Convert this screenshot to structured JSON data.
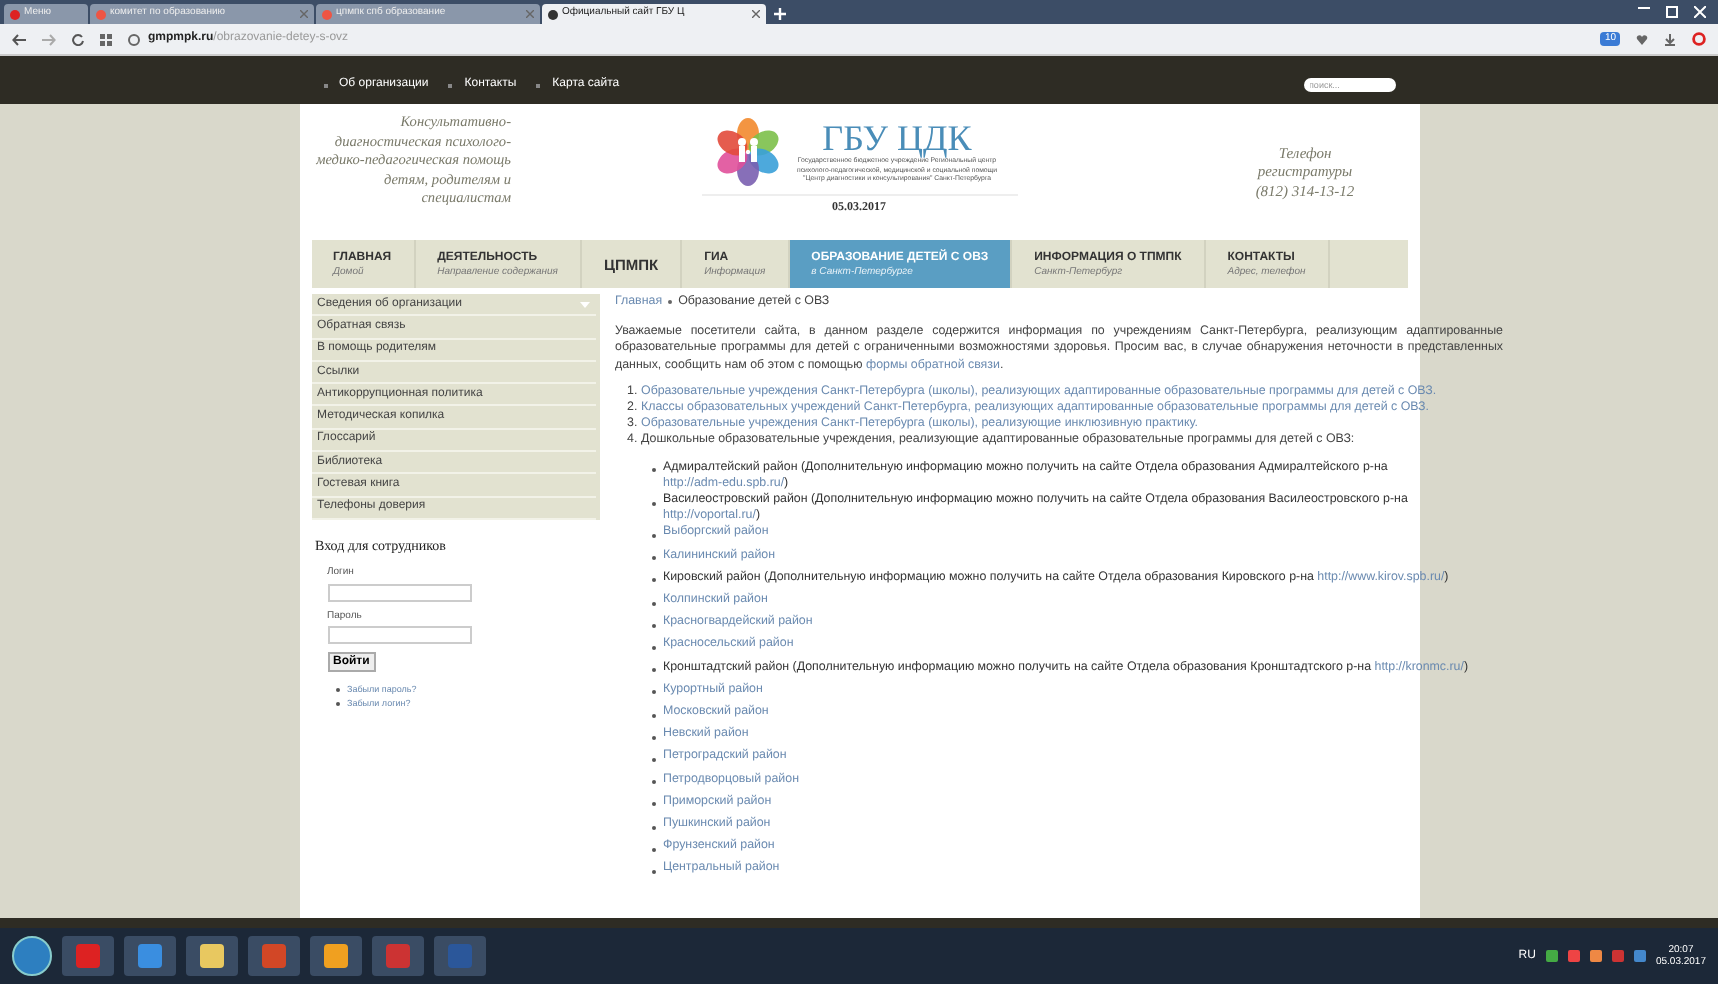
{
  "browser": {
    "tabs": [
      {
        "title": "Меню",
        "selected": false
      },
      {
        "title": "комитет по образованию",
        "selected": false
      },
      {
        "title": "цпмпк спб образование",
        "selected": false
      },
      {
        "title": "Официальный сайт ГБУ Ц",
        "selected": true
      }
    ],
    "url_host": "gmpmpk.ru",
    "url_path": "/obrazovanie-detey-s-ovz",
    "badge": "10"
  },
  "top_links": [
    "Об организации",
    "Контакты",
    "Карта сайта"
  ],
  "search": {
    "placeholder": "поиск..."
  },
  "header": {
    "tagline": "Консультативно-диагностическая психолого-медико-педагогическая помощь детям, родителям и специалистам",
    "logo_title": "ГБУ ЦДК",
    "logo_subtitle": "Государственное бюджетное учреждение Региональный центр психолого-педагогической, медицинской и социальной помощи \"Центр диагностики и консультирования\" Санкт-Петербурга",
    "date": "05.03.2017",
    "phone_label": "Телефон регистратуры",
    "phone": "(812) 314-13-12"
  },
  "menu": [
    {
      "title": "ГЛАВНАЯ",
      "subtitle": "Домой",
      "selected": false
    },
    {
      "title": "ДЕЯТЕЛЬНОСТЬ",
      "subtitle": "Направление содержания",
      "selected": false
    },
    {
      "title": "ЦПМПК",
      "selected": false
    },
    {
      "title": "ГИА",
      "subtitle": "Информация",
      "selected": false
    },
    {
      "title": "ОБРАЗОВАНИЕ ДЕТЕЙ С ОВЗ",
      "subtitle": "в Санкт-Петербурге",
      "selected": true
    },
    {
      "title": "ИНФОРМАЦИЯ О ТПМПК",
      "subtitle": "Санкт-Петербург",
      "selected": false
    },
    {
      "title": "КОНТАКТЫ",
      "subtitle": "Адрес, телефон",
      "selected": false
    }
  ],
  "sidebar": {
    "items": [
      {
        "label": "Сведения об организации",
        "expanded": false
      },
      {
        "label": "Обратная связь"
      },
      {
        "label": "В помощь родителям"
      },
      {
        "label": "Ссылки"
      },
      {
        "label": "Антикоррупционная политика"
      },
      {
        "label": "Методическая копилка"
      },
      {
        "label": "Глоссарий"
      },
      {
        "label": "Библиотека"
      },
      {
        "label": "Гостевая книга"
      },
      {
        "label": "Телефоны доверия"
      }
    ]
  },
  "login": {
    "title": "Вход для сотрудников",
    "fields": [
      {
        "label": "Логин"
      },
      {
        "label": "Пароль"
      }
    ],
    "button": "Войти",
    "links": [
      "Забыли пароль?",
      "Забыли логин?"
    ]
  },
  "content": {
    "breadcrumb": [
      "Главная",
      "Образование детей с ОВЗ"
    ],
    "intro": "Уважаемые посетители сайта, в данном разделе содержится информация по учреждениям Санкт-Петербурга, реализующим адаптированные образовательные программы для детей с ограниченными возможностями здоровья. Просим вас, в случае обнаружения неточности в представленных данных, сообщить нам об этом с помощью ",
    "intro_link": "формы обратной связи",
    "intro_end": ".",
    "list": [
      {
        "number": "1.",
        "kind": "link",
        "text": "Образовательные учреждения Санкт-Петербурга (школы), реализующих адаптированные образовательные программы для детей с ОВЗ."
      },
      {
        "number": "2.",
        "kind": "link",
        "text": "Классы образовательных учреждений Санкт-Петербурга, реализующих адаптированные образовательные программы для детей с ОВЗ."
      },
      {
        "number": "3.",
        "kind": "link",
        "text": "Образовательные учреждения Санкт-Петербурга (школы), реализующие инклюзивную практику."
      },
      {
        "number": "4.",
        "kind": "plain",
        "text": "Дошкольные образовательные учреждения, реализующие адаптированные образовательные программы для детей с ОВЗ:"
      }
    ],
    "districts": [
      {
        "kind": "info",
        "text": "Адмиралтейский район (Дополнительную информацию можно получить на сайте Отдела образования Адмиралтейского р-на ",
        "url": "http://adm-edu.spb.ru/",
        "end": ")"
      },
      {
        "kind": "info",
        "text": "Василеостровский район (Дополнительную информацию можно получить на сайте Отдела образования Василеостровского р-на ",
        "url": "http://voportal.ru/",
        "end": ")"
      },
      {
        "kind": "link",
        "text": "Выборгский район"
      },
      {
        "kind": "link",
        "text": "Калининский район"
      },
      {
        "kind": "info",
        "text": "Кировский район (Дополнительную информацию можно получить на сайте Отдела образования Кировского р-на ",
        "url": "http://www.kirov.spb.ru/",
        "end": ")"
      },
      {
        "kind": "link",
        "text": "Колпинский район"
      },
      {
        "kind": "link",
        "text": "Красногвардейский район"
      },
      {
        "kind": "link",
        "text": "Красносельский район"
      },
      {
        "kind": "info",
        "text": "Кронштадтский район (Дополнительную информацию можно получить на сайте Отдела образования Кронштадтского р-на ",
        "url": "http://kronmc.ru/",
        "end": ")"
      },
      {
        "kind": "link",
        "text": "Курортный район"
      },
      {
        "kind": "link",
        "text": "Московский район"
      },
      {
        "kind": "link",
        "text": "Невский район"
      },
      {
        "kind": "link",
        "text": "Петроградский район"
      },
      {
        "kind": "link",
        "text": "Петродворцовый район"
      },
      {
        "kind": "link",
        "text": "Приморский район"
      },
      {
        "kind": "link",
        "text": "Пушкинский район"
      },
      {
        "kind": "link",
        "text": "Фрунзенский район"
      },
      {
        "kind": "link",
        "text": "Центральный район"
      }
    ]
  },
  "taskbar": {
    "language": "RU",
    "time": "20:07",
    "date": "05.03.2017"
  }
}
